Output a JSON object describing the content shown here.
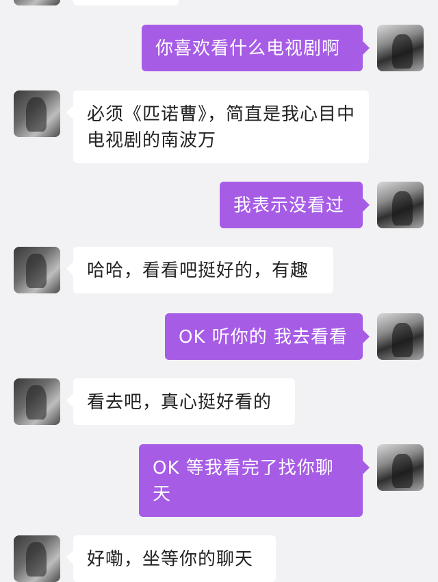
{
  "colors": {
    "background": "#f2f2f4",
    "incoming_bubble": "#ffffff",
    "outgoing_bubble": "#a75ce6",
    "incoming_text": "#222222",
    "outgoing_text": "#ffffff"
  },
  "messages": [
    {
      "sender": "me",
      "text": "你喜欢看什么电视剧啊"
    },
    {
      "sender": "friend",
      "text": "必须《匹诺曹》，简直是我心目中电视剧的南波万"
    },
    {
      "sender": "me",
      "text": "我表示没看过"
    },
    {
      "sender": "friend",
      "text": "哈哈，看看吧挺好的，有趣"
    },
    {
      "sender": "me",
      "text": "OK 听你的 我去看看"
    },
    {
      "sender": "friend",
      "text": "看去吧，真心挺好看的"
    },
    {
      "sender": "me",
      "text": "OK 等我看完了找你聊天"
    },
    {
      "sender": "friend",
      "text": "好嘞，坐等你的聊天"
    }
  ]
}
